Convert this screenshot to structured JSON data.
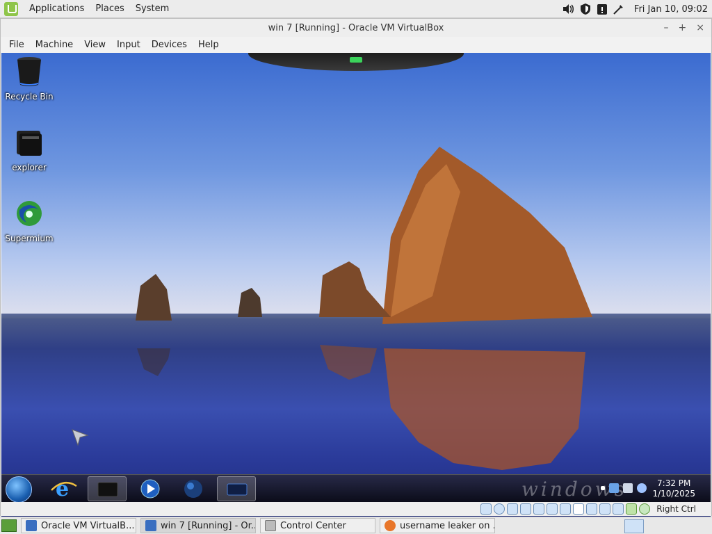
{
  "top_panel": {
    "menus": [
      "Applications",
      "Places",
      "System"
    ],
    "clock": "Fri Jan 10, 09:02",
    "tray_icons": [
      "volume-icon",
      "shield-icon",
      "clipboard-alert-icon",
      "network-icon"
    ]
  },
  "window": {
    "title": "win 7 [Running] - Oracle VM VirtualBox",
    "controls": [
      "–",
      "+",
      "×"
    ],
    "menubar": [
      "File",
      "Machine",
      "View",
      "Input",
      "Devices",
      "Help"
    ]
  },
  "guest": {
    "desktop_icons": [
      {
        "label": "Recycle Bin",
        "icon": "recycle-bin-icon"
      },
      {
        "label": "explorer",
        "icon": "folder-stack-icon"
      },
      {
        "label": "Supermium",
        "icon": "browser-swirl-icon"
      }
    ],
    "taskbar": {
      "clock_time": "7:32 PM",
      "clock_date": "1/10/2025",
      "watermark": "windows",
      "pinned": [
        "internet-explorer-icon",
        "explorer-icon",
        "media-player-icon",
        "globe-icon",
        "virtualbox-icon"
      ]
    }
  },
  "vbox_status": {
    "host_key": "Right Ctrl"
  },
  "bottom_panel": {
    "tasks": [
      {
        "label": "Oracle VM VirtualB...",
        "icon": "virtualbox-icon",
        "active": false
      },
      {
        "label": "win 7 [Running] - Or...",
        "icon": "virtualbox-icon",
        "active": true
      },
      {
        "label": "Control Center",
        "icon": "control-center-icon",
        "active": false
      },
      {
        "label": "username leaker on ...",
        "icon": "firefox-icon",
        "active": false
      }
    ]
  },
  "colors": {
    "accent": "#8fc54a",
    "vm_indicator": "#3bd35b"
  }
}
